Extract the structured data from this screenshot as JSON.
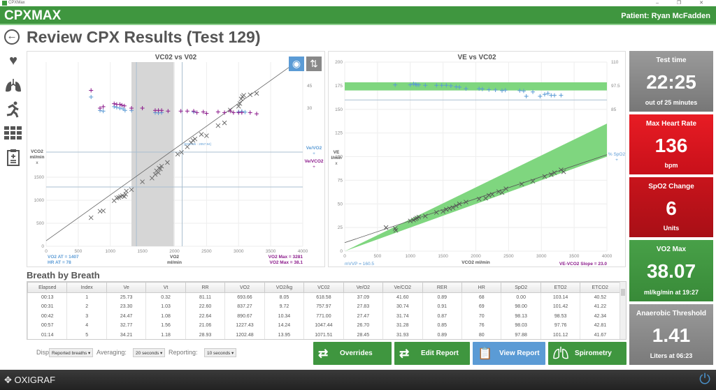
{
  "window": {
    "title": "CPXMax",
    "controls": "– ❐ ✕"
  },
  "header": {
    "brand": "CPXMAX",
    "patient": "Patient: Ryan McFadden"
  },
  "page": {
    "title": "Review CPX Results (Test 129)",
    "back_icon": "arrow-left-circle"
  },
  "sidebar": {
    "items": [
      {
        "icon": "heart"
      },
      {
        "icon": "lungs"
      },
      {
        "icon": "runner"
      },
      {
        "icon": "grid"
      },
      {
        "icon": "clipboard-plus"
      }
    ]
  },
  "colors": {
    "green": "#3f963f",
    "red": "#e0141e",
    "darkred": "#c0141c",
    "gray": "#8a8a8a",
    "blue": "#5b9bd5",
    "purple": "#8b1a8b",
    "band": "#7fd67f"
  },
  "chart_data": [
    {
      "type": "scatter",
      "title": "VC02 vs V02",
      "xlabel": "VO2",
      "xunit": "ml/min",
      "ylabel": "VCO2",
      "yunit": "ml/min",
      "ymarker": "x",
      "xlim": [
        0,
        4000
      ],
      "ylim": [
        0,
        4000
      ],
      "xticks": [
        0,
        500,
        1000,
        1500,
        2000,
        2500,
        3000,
        3500,
        4000
      ],
      "yticks": [
        0,
        500,
        1000,
        1500
      ],
      "y2lim": [
        -63,
        61
      ],
      "y2ticks": [
        30,
        45
      ],
      "grid": true,
      "at_band": [
        1330,
        1990
      ],
      "vlines": [
        1407,
        2120
      ],
      "hlines": [
        2045,
        1288
      ],
      "fit": [
        [
          0,
          120
        ],
        [
          4000,
          4100
        ]
      ],
      "range_label": "[2020.05 - 2057.94]",
      "legend": [
        {
          "name": "Ve/VO2",
          "marker": "+"
        },
        {
          "name": "Ve/VCO2",
          "marker": "+"
        }
      ],
      "footer_left": [
        "VO2 AT = 1407",
        "HR AT = 78"
      ],
      "footer_right": [
        "VO2 Max = 3281",
        "VO2 Max = 38.1"
      ],
      "vco2": [
        [
          700,
          620
        ],
        [
          840,
          760
        ],
        [
          890,
          770
        ],
        [
          1060,
          990
        ],
        [
          1100,
          1050
        ],
        [
          1130,
          1060
        ],
        [
          1160,
          1080
        ],
        [
          1190,
          1100
        ],
        [
          1220,
          1080
        ],
        [
          1240,
          1130
        ],
        [
          1250,
          1200
        ],
        [
          1330,
          1230
        ],
        [
          1500,
          1400
        ],
        [
          1650,
          1480
        ],
        [
          1700,
          1560
        ],
        [
          1720,
          1640
        ],
        [
          1750,
          1600
        ],
        [
          1760,
          1700
        ],
        [
          1780,
          1680
        ],
        [
          1800,
          1740
        ],
        [
          1890,
          1820
        ],
        [
          2050,
          2000
        ],
        [
          2110,
          2040
        ],
        [
          2200,
          2160
        ],
        [
          2260,
          2250
        ],
        [
          2290,
          2300
        ],
        [
          2320,
          2330
        ],
        [
          2420,
          2430
        ],
        [
          2500,
          2400
        ],
        [
          2680,
          2620
        ],
        [
          2780,
          2680
        ],
        [
          2870,
          2960
        ],
        [
          3000,
          3040
        ],
        [
          3020,
          3100
        ],
        [
          3040,
          3200
        ],
        [
          3060,
          3250
        ],
        [
          3080,
          3280
        ],
        [
          3180,
          3290
        ],
        [
          3281,
          3320
        ]
      ],
      "ve_vo2": [
        [
          700,
          37.5
        ],
        [
          840,
          28.5
        ],
        [
          890,
          28
        ],
        [
          1060,
          31
        ],
        [
          1100,
          30.5
        ],
        [
          1150,
          30
        ],
        [
          1200,
          29.5
        ],
        [
          1230,
          28.5
        ],
        [
          1330,
          28.5
        ],
        [
          1700,
          27
        ],
        [
          1750,
          26.8
        ],
        [
          1800,
          27
        ],
        [
          2300,
          27.5
        ],
        [
          3000,
          27.5
        ],
        [
          3050,
          27.8
        ],
        [
          3100,
          27.3
        ]
      ],
      "ve_vco2": [
        [
          700,
          42
        ],
        [
          840,
          30
        ],
        [
          890,
          31
        ],
        [
          1060,
          33
        ],
        [
          1100,
          32.5
        ],
        [
          1150,
          32.5
        ],
        [
          1180,
          32
        ],
        [
          1220,
          31.5
        ],
        [
          1330,
          30
        ],
        [
          1500,
          30
        ],
        [
          1700,
          28.5
        ],
        [
          1750,
          28.5
        ],
        [
          1800,
          28.5
        ],
        [
          1900,
          28
        ],
        [
          2100,
          28
        ],
        [
          2200,
          28
        ],
        [
          2300,
          28
        ],
        [
          2350,
          27
        ],
        [
          2450,
          27.5
        ],
        [
          2500,
          26.5
        ],
        [
          2680,
          27.5
        ],
        [
          2780,
          27
        ],
        [
          2870,
          28
        ],
        [
          2920,
          27
        ],
        [
          3000,
          27
        ],
        [
          3050,
          27
        ],
        [
          3180,
          27
        ],
        [
          3281,
          26.2
        ]
      ]
    },
    {
      "type": "scatter",
      "title": "VE vs VC02",
      "xlabel": "VCO2 ml/min",
      "ylabel": "VE",
      "yunit": "l/min",
      "ymarker": "x",
      "xlim": [
        0,
        4000
      ],
      "ylim": [
        0,
        200
      ],
      "xticks": [
        0,
        500,
        1000,
        1500,
        2000,
        2500,
        3000,
        3500,
        4000
      ],
      "yticks": [
        0,
        25,
        50,
        75,
        100,
        125,
        150,
        175,
        200
      ],
      "y2lim": [
        10.4,
        110
      ],
      "y2ticks": [
        85,
        97.5,
        110
      ],
      "grid": true,
      "spo2_band": [
        170,
        178.6
      ],
      "hline": 160,
      "wedge": {
        "upper_end": 135,
        "lower_end": 100
      },
      "fit": [
        [
          0,
          9
        ],
        [
          4000,
          102
        ]
      ],
      "legend": [
        {
          "name": "% SpO2",
          "marker": "+"
        }
      ],
      "footer_left": "mVVP = 160.5",
      "footer_right": "VE-VCO2 Slope = 23.0",
      "ve": [
        [
          630,
          25
        ],
        [
          770,
          24
        ],
        [
          780,
          22
        ],
        [
          1000,
          32
        ],
        [
          1050,
          33
        ],
        [
          1080,
          34
        ],
        [
          1100,
          35
        ],
        [
          1130,
          36
        ],
        [
          1230,
          37
        ],
        [
          1400,
          41
        ],
        [
          1500,
          42
        ],
        [
          1550,
          44
        ],
        [
          1600,
          45
        ],
        [
          1650,
          46
        ],
        [
          1700,
          48
        ],
        [
          1750,
          50
        ],
        [
          1850,
          52
        ],
        [
          2050,
          55
        ],
        [
          2150,
          56
        ],
        [
          2200,
          59
        ],
        [
          2250,
          60
        ],
        [
          2350,
          63
        ],
        [
          2400,
          62
        ],
        [
          2460,
          66
        ],
        [
          2700,
          71
        ],
        [
          2870,
          74
        ],
        [
          3050,
          79
        ],
        [
          3150,
          81
        ],
        [
          3200,
          83
        ],
        [
          3300,
          86
        ],
        [
          3340,
          84
        ]
      ],
      "spo2": [
        [
          770,
          98
        ],
        [
          1000,
          98
        ],
        [
          1050,
          98.5
        ],
        [
          1080,
          98.3
        ],
        [
          1100,
          98
        ],
        [
          1130,
          98
        ],
        [
          1230,
          97.8
        ],
        [
          1400,
          97.8
        ],
        [
          1480,
          97.8
        ],
        [
          1550,
          97.8
        ],
        [
          1620,
          97.5
        ],
        [
          1700,
          97
        ],
        [
          1750,
          96.8
        ],
        [
          1850,
          96
        ],
        [
          2050,
          96
        ],
        [
          2100,
          95.8
        ],
        [
          2200,
          95.5
        ],
        [
          2300,
          95.3
        ],
        [
          2400,
          95
        ],
        [
          2450,
          95.2
        ],
        [
          2670,
          95
        ],
        [
          2730,
          94.8
        ],
        [
          2770,
          92
        ],
        [
          2870,
          94.3
        ],
        [
          2980,
          92
        ],
        [
          3050,
          93
        ],
        [
          3100,
          93.5
        ],
        [
          3150,
          92.5
        ],
        [
          3200,
          92.5
        ],
        [
          3300,
          92.5
        ]
      ]
    }
  ],
  "cards": [
    {
      "title": "Test time",
      "value": "22:25",
      "sub": "out of 25 minutes"
    },
    {
      "title": "Max Heart Rate",
      "value": "136",
      "sub": "bpm"
    },
    {
      "title": "SpO2 Change",
      "value": "6",
      "sub": "Units"
    },
    {
      "title": "VO2 Max",
      "value": "38.07",
      "sub": "ml/kg/min at 19:27"
    },
    {
      "title": "Anaerobic Threshold",
      "value": "1.41",
      "sub": "Liters at 06:23"
    }
  ],
  "table": {
    "title": "Breath by Breath",
    "columns": [
      "Elapsed",
      "Index",
      "Ve",
      "Vt",
      "RR",
      "VO2",
      "VO2/kg",
      "VC02",
      "Ve/O2",
      "Ve/CO2",
      "RER",
      "HR",
      "SpO2",
      "ETO2",
      "ETCO2"
    ],
    "rows": [
      [
        "00:13",
        "1",
        "25.73",
        "0.32",
        "81.11",
        "693.66",
        "8.05",
        "618.58",
        "37.09",
        "41.60",
        "0.89",
        "68",
        "0.00",
        "103.14",
        "40.52"
      ],
      [
        "00:31",
        "2",
        "23.30",
        "1.03",
        "22.60",
        "837.27",
        "9.72",
        "757.97",
        "27.83",
        "30.74",
        "0.91",
        "69",
        "98.00",
        "101.42",
        "41.22"
      ],
      [
        "00:42",
        "3",
        "24.47",
        "1.08",
        "22.64",
        "890.67",
        "10.34",
        "771.00",
        "27.47",
        "31.74",
        "0.87",
        "70",
        "98.13",
        "98.53",
        "42.34"
      ],
      [
        "00:57",
        "4",
        "32.77",
        "1.56",
        "21.06",
        "1227.43",
        "14.24",
        "1047.44",
        "26.70",
        "31.28",
        "0.85",
        "76",
        "98.03",
        "97.76",
        "42.81"
      ],
      [
        "01:14",
        "5",
        "34.21",
        "1.18",
        "28.93",
        "1202.48",
        "13.95",
        "1071.51",
        "28.45",
        "31.93",
        "0.89",
        "80",
        "97.88",
        "101.12",
        "41.67"
      ],
      [
        "01:29",
        "6",
        "33.77",
        "0.89",
        "36.96",
        "1056.60",
        "12.25",
        "964.73",
        "31.95",
        "33.97",
        "0.91",
        "80",
        "97.80",
        "102.43",
        "41.87"
      ]
    ]
  },
  "controls": {
    "display_label": "Display:",
    "display_value": "Reported breaths",
    "averaging_label": "Averaging:",
    "averaging_value": "20 seconds",
    "reporting_label": "Reporting:",
    "reporting_value": "10 seconds"
  },
  "actions": [
    {
      "label": "Overrides",
      "icon": "swap-arrows"
    },
    {
      "label": "Edit Report",
      "icon": "swap-arrows"
    },
    {
      "label": "View Report",
      "icon": "clipboard"
    },
    {
      "label": "Spirometry",
      "icon": "lungs"
    }
  ],
  "footer": {
    "logo": "OXIGRAF"
  }
}
